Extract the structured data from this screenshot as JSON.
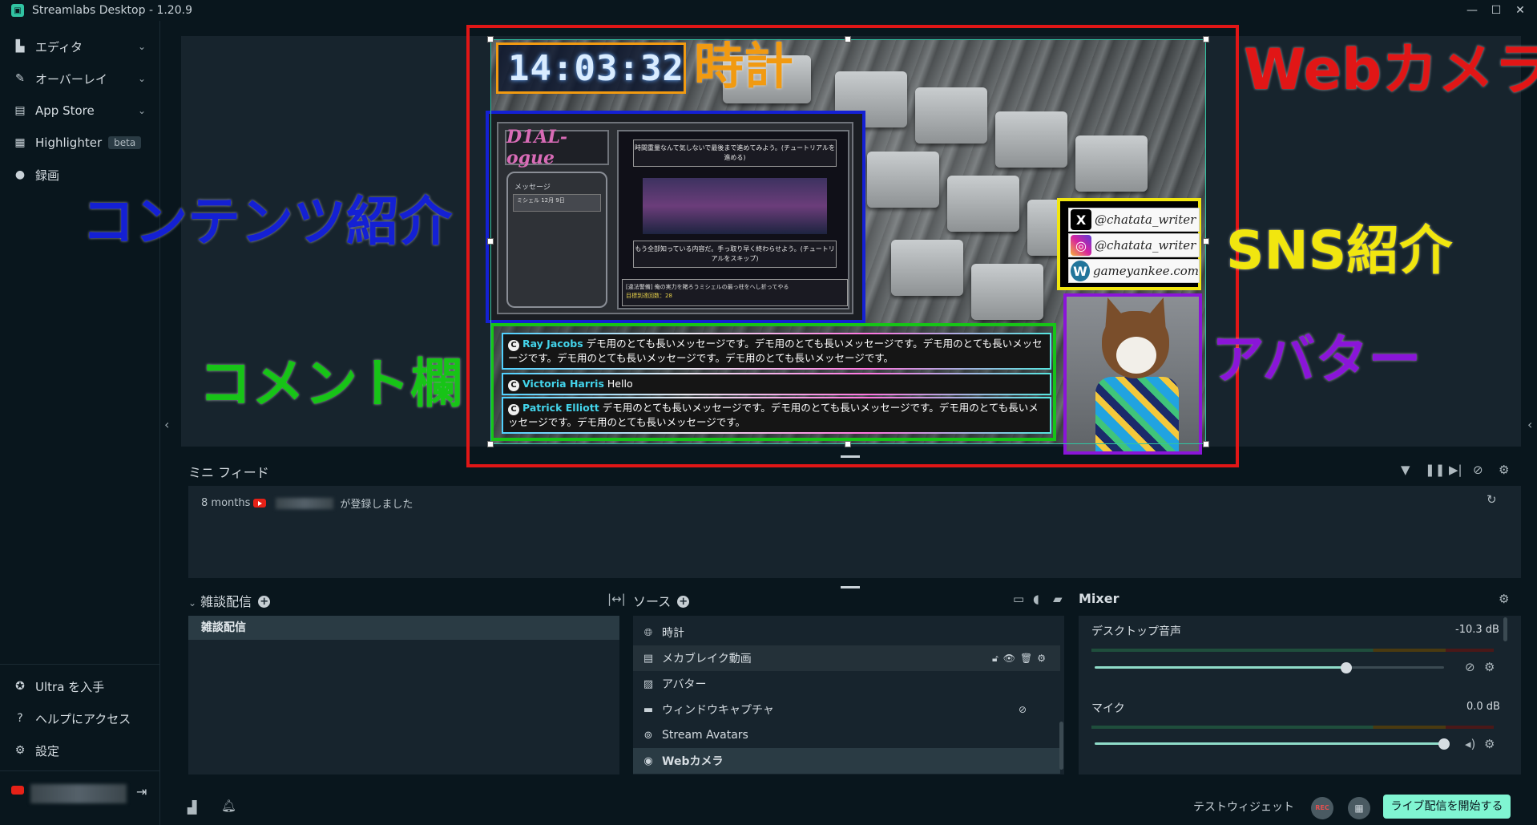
{
  "window": {
    "title": "Streamlabs Desktop - 1.20.9",
    "controls": [
      "—",
      "☐",
      "✕"
    ]
  },
  "sidebar": {
    "items": [
      {
        "label": "エディタ",
        "icon": "editor-icon",
        "has_chevron": true
      },
      {
        "label": "オーバーレイ",
        "icon": "overlay-icon",
        "has_chevron": true
      },
      {
        "label": "App Store",
        "icon": "store-icon",
        "has_chevron": true
      },
      {
        "label": "Highlighter",
        "icon": "highlighter-icon",
        "badge": "beta"
      },
      {
        "label": "録画",
        "icon": "record-icon"
      }
    ],
    "bottom_items": [
      {
        "label": "Ultra を入手",
        "icon": "ultra-icon"
      },
      {
        "label": "ヘルプにアクセス",
        "icon": "help-icon"
      },
      {
        "label": "設定",
        "icon": "gear-icon"
      }
    ],
    "logout_icon": "⇥"
  },
  "preview": {
    "clock": "14:03:32",
    "game": {
      "logo": "D1AL-ogue",
      "phone_label": "メッセージ",
      "phone_msg": "ミシェル  12月 9日",
      "dialog_1": "時間重量なんて気しないで最後まで進めてみよう。(チュートリアルを進める)",
      "dialog_2": "もう全部知っている内容だ。手っ取り早く終わらせよう。(チュートリアルをスキップ)",
      "bottom_text": "[違法警備] 俺の実力を賭ろうミシェルの最っ柱をへし折ってやる",
      "bottom_sub": "目標到達回数：28"
    },
    "sns": [
      {
        "icon": "x-icon",
        "glyph": "X",
        "color": "#000000",
        "text": "@chatata_writer"
      },
      {
        "icon": "instagram-icon",
        "glyph": "◎",
        "color": "#d6249f",
        "text": "@chatata_writer"
      },
      {
        "icon": "wordpress-icon",
        "glyph": "W",
        "color": "#21759b",
        "text": "gameyankee.com"
      }
    ],
    "comments": [
      {
        "name": "Ray Jacobs",
        "text": "デモ用のとても長いメッセージです。デモ用のとても長いメッセージです。デモ用のとても長いメッセージです。デモ用のとても長いメッセージです。デモ用のとても長いメッセージです。"
      },
      {
        "name": "Victoria Harris",
        "text": "Hello"
      },
      {
        "name": "Patrick Elliott",
        "text": "デモ用のとても長いメッセージです。デモ用のとても長いメッセージです。デモ用のとても長いメッセージです。デモ用のとても長いメッセージです。"
      }
    ],
    "annotations": {
      "webcam": {
        "text": "Webカメラ",
        "color": "#e11616"
      },
      "clock": {
        "text": "時計",
        "color": "#f19a11"
      },
      "content": {
        "text": "コンテンツ紹介",
        "color": "#1420d4"
      },
      "sns": {
        "text": "SNS紹介",
        "color": "#f1e60f"
      },
      "comment": {
        "text": "コメント欄",
        "color": "#17c417"
      },
      "avatar": {
        "text": "アバター",
        "color": "#8a15d8"
      }
    }
  },
  "mini_feed": {
    "title": "ミニ フィード",
    "entries": [
      {
        "time": "8 months",
        "text": "が登録しました"
      }
    ]
  },
  "scenes": {
    "title": "雑談配信",
    "items": [
      "雑談配信"
    ]
  },
  "sources": {
    "title": "ソース",
    "items": [
      {
        "label": "時計",
        "icon": "globe-icon",
        "glyph": "🌐︎"
      },
      {
        "label": "メカブレイク動画",
        "icon": "file-icon",
        "glyph": "▤",
        "actions": "🔓︎👁︎🗑︎⚙︎"
      },
      {
        "label": "アバター",
        "icon": "image-icon",
        "glyph": "▨"
      },
      {
        "label": "ウィンドウキャプチャ",
        "icon": "window-icon",
        "glyph": "▬",
        "actions": "⊘"
      },
      {
        "label": "Stream Avatars",
        "icon": "gamepad-icon",
        "glyph": "⊚"
      },
      {
        "label": "Webカメラ",
        "icon": "webcam-icon",
        "glyph": "◉"
      }
    ]
  },
  "mixer": {
    "title": "Mixer",
    "channels": [
      {
        "label": "デスクトップ音声",
        "db": "-10.3 dB",
        "level": 0.68
      },
      {
        "label": "マイク",
        "db": "0.0 dB",
        "level": 1.0
      }
    ]
  },
  "footer": {
    "test_widget": "テストウィジェット",
    "rec": "REC",
    "go_live": "ライブ配信を開始する"
  }
}
